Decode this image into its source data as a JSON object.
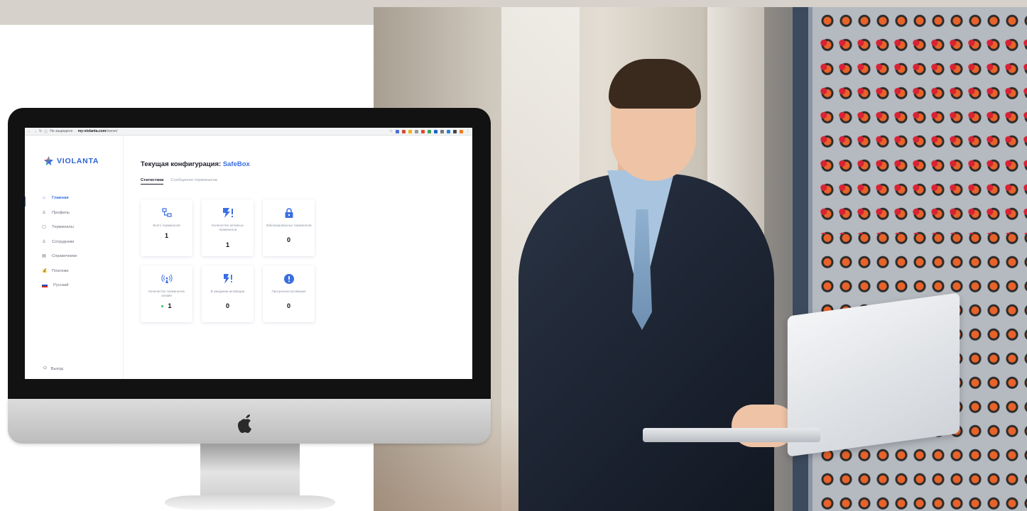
{
  "browser": {
    "security_label": "Не защищено",
    "url_host": "my-violanta.com",
    "url_path": "/owner/"
  },
  "sidebar": {
    "brand": "VIOLANTA",
    "items": [
      {
        "label": "Главная",
        "icon": "home-icon"
      },
      {
        "label": "Профиль",
        "icon": "user-icon"
      },
      {
        "label": "Терминалы",
        "icon": "terminal-icon"
      },
      {
        "label": "Сотрудники",
        "icon": "staff-icon"
      },
      {
        "label": "Справочники",
        "icon": "reference-icon"
      },
      {
        "label": "Платежи",
        "icon": "payment-icon"
      },
      {
        "label": "Русский",
        "icon": "russian-flag-icon"
      }
    ],
    "logout": "Выход"
  },
  "main": {
    "title_prefix": "Текущая конфигурация:",
    "title_accent": "SafeBox",
    "tabs": [
      "Статистика",
      "Сообщения терминалов"
    ],
    "cards": [
      {
        "label": "Всего терминалов",
        "value": "1",
        "icon": "network-icon"
      },
      {
        "label": "Количество активных терминалов",
        "value": "1",
        "icon": "active-flash-icon"
      },
      {
        "label": "Заблокированных терминалов",
        "value": "0",
        "icon": "lock-icon"
      },
      {
        "label": "Количество терминалов онлайн",
        "value": "1",
        "icon": "wifi-tower-icon"
      },
      {
        "label": "В ожидании активации",
        "value": "0",
        "icon": "pending-flash-icon"
      },
      {
        "label": "Просрочена активация",
        "value": "0",
        "icon": "alert-icon"
      }
    ]
  },
  "colors": {
    "accent": "#3b6fe0",
    "online_dot": "#2ec26a",
    "bezel": "#121212"
  }
}
